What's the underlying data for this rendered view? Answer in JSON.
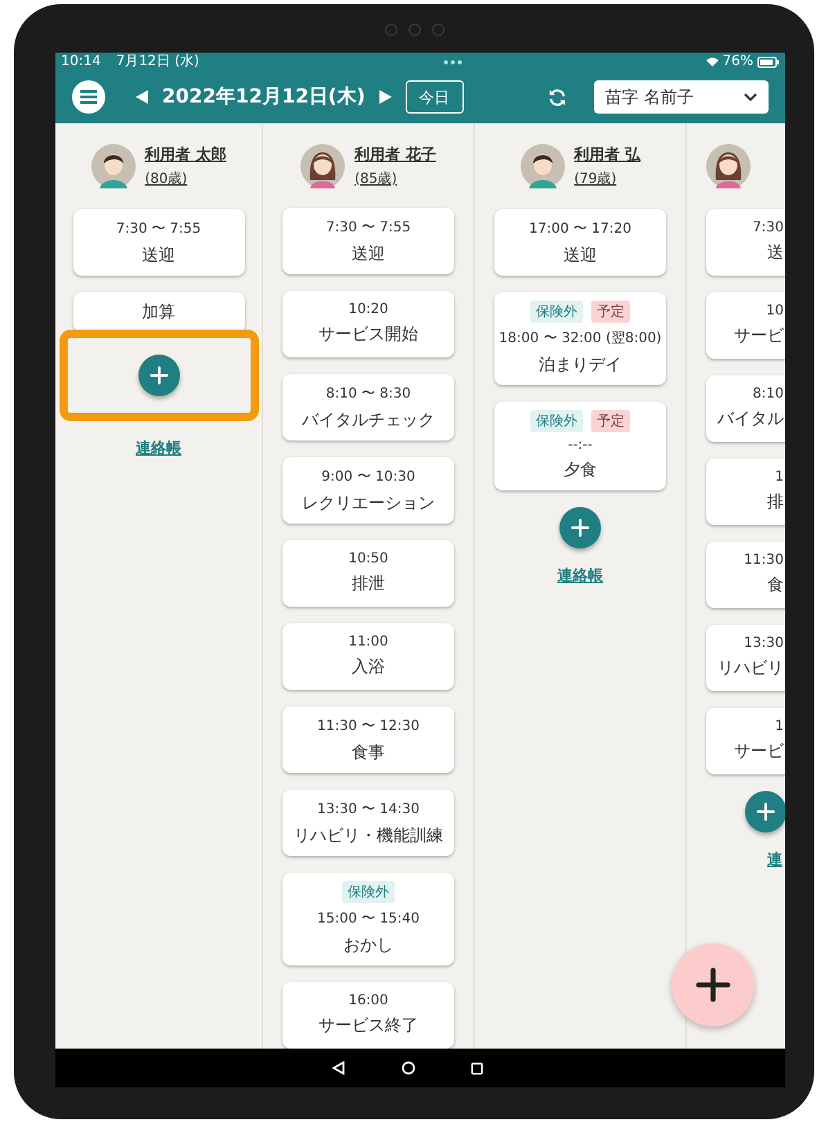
{
  "status_bar": {
    "time": "10:14",
    "date": "7月12日 (水)",
    "battery": "76%"
  },
  "header": {
    "date": "2022年12月12日(木)",
    "today_button": "今日",
    "staff_select": "苗字 名前子"
  },
  "columns": [
    {
      "kind": "male",
      "name": "利用者 太郎",
      "age": "(80歳)",
      "cards": [
        {
          "time": "7:30 〜 7:55",
          "title": "送迎"
        },
        {
          "title": "加算"
        }
      ],
      "add_button": {
        "highlighted": true
      },
      "notes_link": "連絡帳"
    },
    {
      "kind": "female",
      "name": "利用者 花子",
      "age": "(85歳)",
      "cards": [
        {
          "time": "7:30 〜 7:55",
          "title": "送迎"
        },
        {
          "time": "10:20",
          "title": "サービス開始"
        },
        {
          "time": "8:10 〜 8:30",
          "title": "バイタルチェック"
        },
        {
          "time": "9:00 〜 10:30",
          "title": "レクリエーション"
        },
        {
          "time": "10:50",
          "title": "排泄"
        },
        {
          "time": "11:00",
          "title": "入浴"
        },
        {
          "time": "11:30 〜 12:30",
          "title": "食事"
        },
        {
          "time": "13:30 〜 14:30",
          "title": "リハビリ・機能訓練"
        },
        {
          "tags": [
            {
              "kind": "insurance",
              "label": "保険外"
            }
          ],
          "time": "15:00 〜 15:40",
          "title": "おかし"
        },
        {
          "time": "16:00",
          "title": "サービス終了"
        }
      ]
    },
    {
      "kind": "male",
      "name": "利用者 弘",
      "age": "(79歳)",
      "cards": [
        {
          "time": "17:00 〜 17:20",
          "title": "送迎"
        },
        {
          "tags": [
            {
              "kind": "insurance",
              "label": "保険外"
            },
            {
              "kind": "plan",
              "label": "予定"
            }
          ],
          "time": "18:00 〜 32:00 (翌8:00)",
          "title": "泊まりデイ"
        },
        {
          "tags": [
            {
              "kind": "insurance",
              "label": "保険外"
            },
            {
              "kind": "plan",
              "label": "予定"
            }
          ],
          "time": "--:--",
          "title": "夕食"
        }
      ],
      "add_button": {
        "highlighted": false
      },
      "notes_link": "連絡帳"
    },
    {
      "kind": "female",
      "cards": [
        {
          "time": "7:30",
          "title": "送"
        },
        {
          "time": "10",
          "title": "サービ"
        },
        {
          "time": "8:10",
          "title": "バイタル"
        },
        {
          "time": "1",
          "title": "排"
        },
        {
          "time": "11:30",
          "title": "食"
        },
        {
          "time": "13:30",
          "title": "リハビリ"
        },
        {
          "time": "1",
          "title": "サービ"
        }
      ],
      "add_button": {
        "highlighted": false
      },
      "notes_link": "連"
    }
  ]
}
